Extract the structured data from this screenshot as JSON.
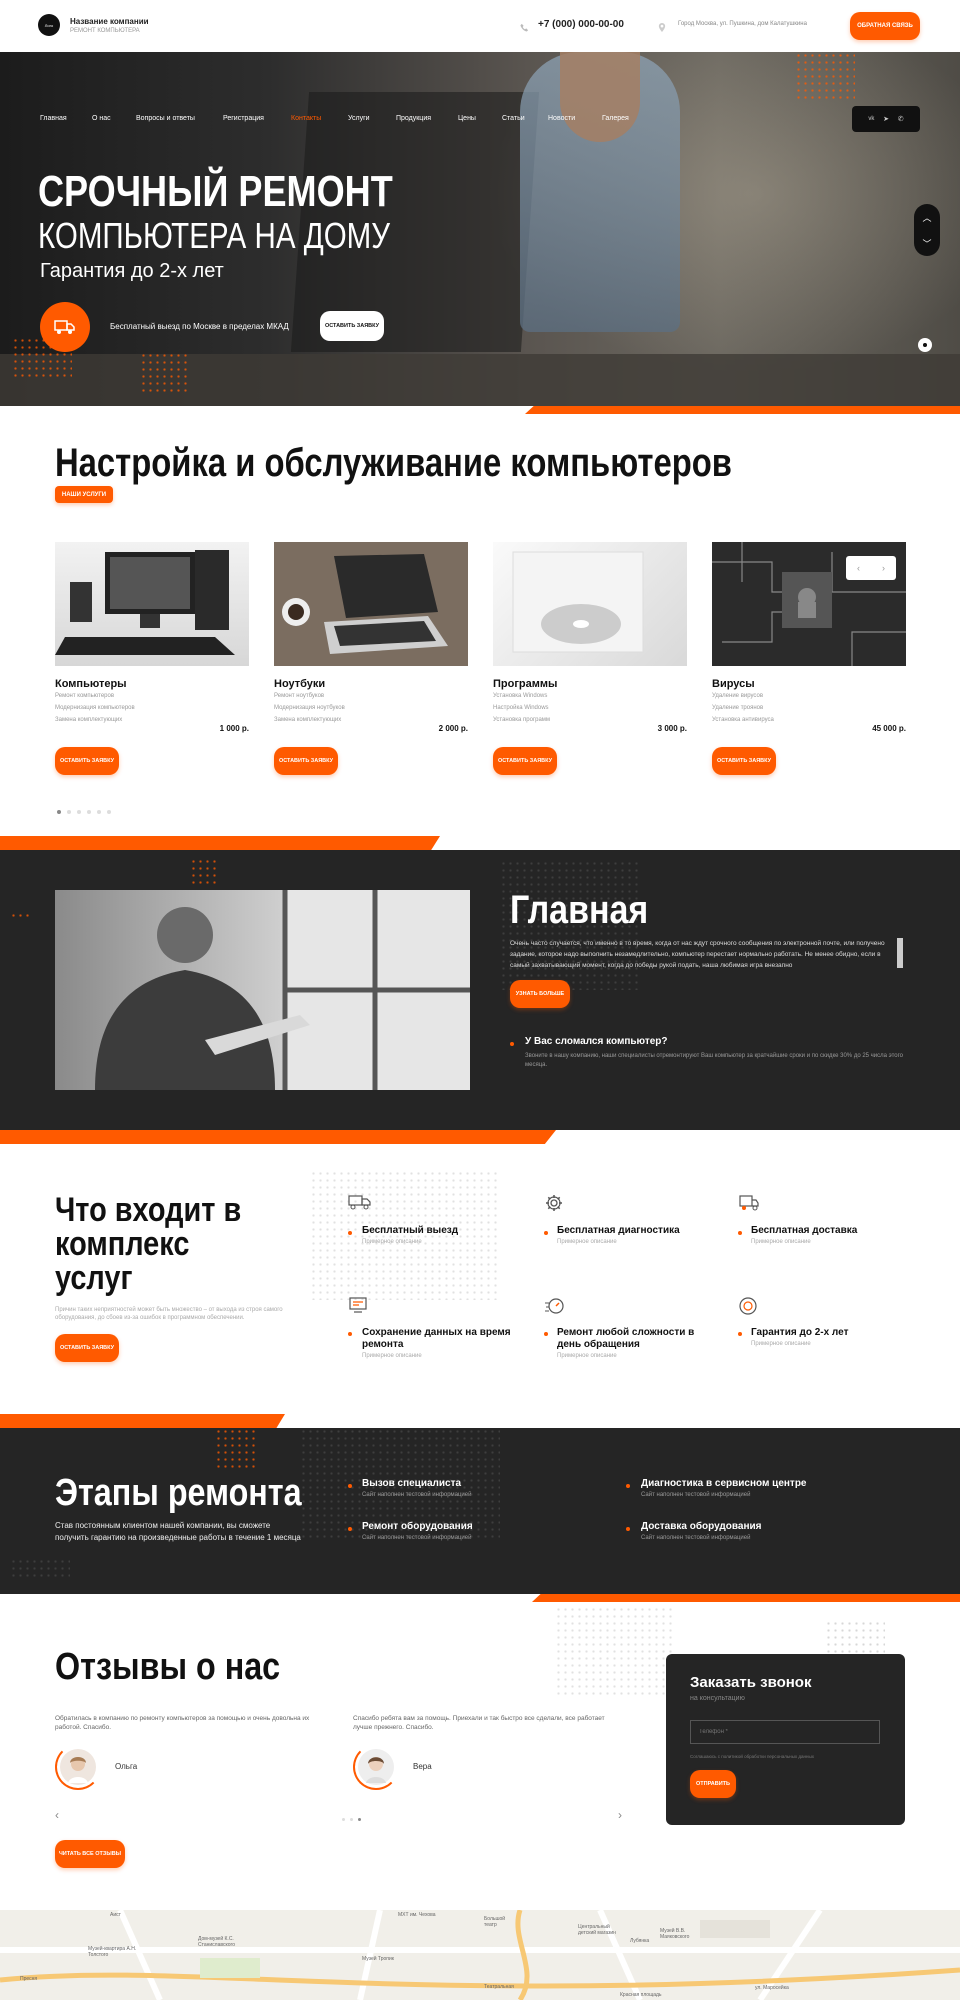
{
  "header": {
    "logo_text": "Лого",
    "company_name": "Название компании",
    "company_sub": "РЕМОНТ КОМПЬЮТЕРА",
    "phone": "+7 (000) 000-00-00",
    "address": "Город Москва, ул. Пушкина, дом Калатушкина",
    "callback_button": "ОБРАТНАЯ СВЯЗЬ"
  },
  "nav": {
    "items": [
      "Главная",
      "О нас",
      "Вопросы и ответы",
      "Регистрация",
      "Контакты",
      "Услуги",
      "Продукция",
      "Цены",
      "Статьи",
      "Новости",
      "Галерея"
    ],
    "active": "Контакты",
    "social": [
      "vk",
      "tg",
      "wa"
    ]
  },
  "hero": {
    "title_line1": "СРОЧНЫЙ РЕМОНТ",
    "title_line2": "КОМПЬЮТЕРА НА ДОМУ",
    "guarantee": "Гарантия до 2-х лет",
    "free_visit": "Бесплатный выезд по Москве в пределах МКАД",
    "cta_button": "ОСТАВИТЬ ЗАЯВКУ"
  },
  "services": {
    "title": "Настройка и обслуживание компьютеров",
    "badge": "НАШИ УСЛУГИ",
    "cards": [
      {
        "title": "Компьютеры",
        "lines": [
          "Ремонт компьютеров",
          "Модернизация компьютеров",
          "Замена комплектующих"
        ],
        "price": "1 000 р.",
        "button": "ОСТАВИТЬ ЗАЯВКУ"
      },
      {
        "title": "Ноутбуки",
        "lines": [
          "Ремонт ноутбуков",
          "Модернизация ноутбуков",
          "Замена комплектующих"
        ],
        "price": "2 000 р.",
        "button": "ОСТАВИТЬ ЗАЯВКУ"
      },
      {
        "title": "Программы",
        "lines": [
          "Установка Windows",
          "Настройка Windows",
          "Установка программ"
        ],
        "price": "3 000 р.",
        "button": "ОСТАВИТЬ ЗАЯВКУ"
      },
      {
        "title": "Вирусы",
        "lines": [
          "Удаление вирусов",
          "Удаление троянов",
          "Установка антивируса"
        ],
        "price": "45 000 р.",
        "button": "ОСТАВИТЬ ЗАЯВКУ"
      }
    ]
  },
  "about": {
    "title": "Главная",
    "text": "Очень часто случается, что именно в то время, когда от нас ждут срочного сообщения по электронной почте, или получено задание, которое надо выполнить незамедлительно, компьютер перестает нормально работать. Не менее обидно, если в самый захватывающий момент, когда до победы рукой подать, наша любимая игра внезапно",
    "more_button": "УЗНАТЬ БОЛЬШЕ",
    "question": "У Вас сломался компьютер?",
    "answer": "Звоните в нашу компанию, наши специалисты отремонтируют Ваш компьютер за кратчайшие сроки и по скидке 30% до 25 числа этого месяца."
  },
  "complex": {
    "title_line1": "Что входит в",
    "title_line2": "комплекс",
    "title_line3": "услуг",
    "text": "Причин таких неприятностей может быть множество – от выхода из строя самого оборудования, до сбоев из-за ошибок в программном обеспечении.",
    "button": "ОСТАВИТЬ ЗАЯВКУ",
    "features": [
      {
        "icon": "truck-icon",
        "title": "Бесплатный выезд",
        "sub": "Примерное описание"
      },
      {
        "icon": "gear-icon",
        "title": "Бесплатная диагностика",
        "sub": "Примерное описание"
      },
      {
        "icon": "delivery-icon",
        "title": "Бесплатная доставка",
        "sub": "Примерное описание"
      },
      {
        "icon": "data-icon",
        "title": "Сохранение данных на время ремонта",
        "sub": "Примерное описание"
      },
      {
        "icon": "speed-icon",
        "title": "Ремонт любой сложности в день обращения",
        "sub": "Примерное описание"
      },
      {
        "icon": "medal-icon",
        "title": "Гарантия до 2-х лет",
        "sub": "Примерное описание"
      }
    ]
  },
  "stages": {
    "title": "Этапы ремонта",
    "text": "Став постоянным клиентом нашей компании, вы сможете получить гарантию на произведенные работы в течение 1 месяца",
    "items": [
      {
        "title": "Вызов специалиста",
        "sub": "Сайт наполнен тестовой информацией"
      },
      {
        "title": "Диагностика в сервисном центре",
        "sub": "Сайт наполнен тестовой информацией"
      },
      {
        "title": "Ремонт оборудования",
        "sub": "Сайт наполнен тестовой информацией"
      },
      {
        "title": "Доставка оборудования",
        "sub": "Сайт наполнен тестовой информацией"
      }
    ]
  },
  "reviews": {
    "title": "Отзывы о нас",
    "items": [
      {
        "text": "Обратилась в компанию по ремонту компьютеров за помощью и очень довольна их работой. Спасибо.",
        "name": "Ольга"
      },
      {
        "text": "Спасибо ребята вам за помощь. Приехали и так быстро все сделали, все работает лучше прежнего. Спасибо.",
        "name": "Вера"
      }
    ],
    "button": "ЧИТАТЬ ВСЕ ОТЗЫВЫ"
  },
  "callback": {
    "title": "Заказать звонок",
    "sub": "на консультацию",
    "phone_placeholder": "Телефон *",
    "consent": "Соглашаюсь с политикой обработки персональных данных",
    "button": "ОТПРАВИТЬ"
  },
  "map": {
    "labels": [
      "Аист",
      "МХТ им. Чехова",
      "Большой театр",
      "Центральный детский магазин",
      "Музей В.В. Маяковского",
      "Дом-музей К.С. Станиславского",
      "Музей-квартира А.Н. Толстого",
      "Музей Тропик",
      "Театральная",
      "Лубянка",
      "Красная площадь",
      "ул. Маросейка",
      "Пресня"
    ]
  },
  "colors": {
    "accent": "#ff5a00",
    "dark": "#252525"
  }
}
